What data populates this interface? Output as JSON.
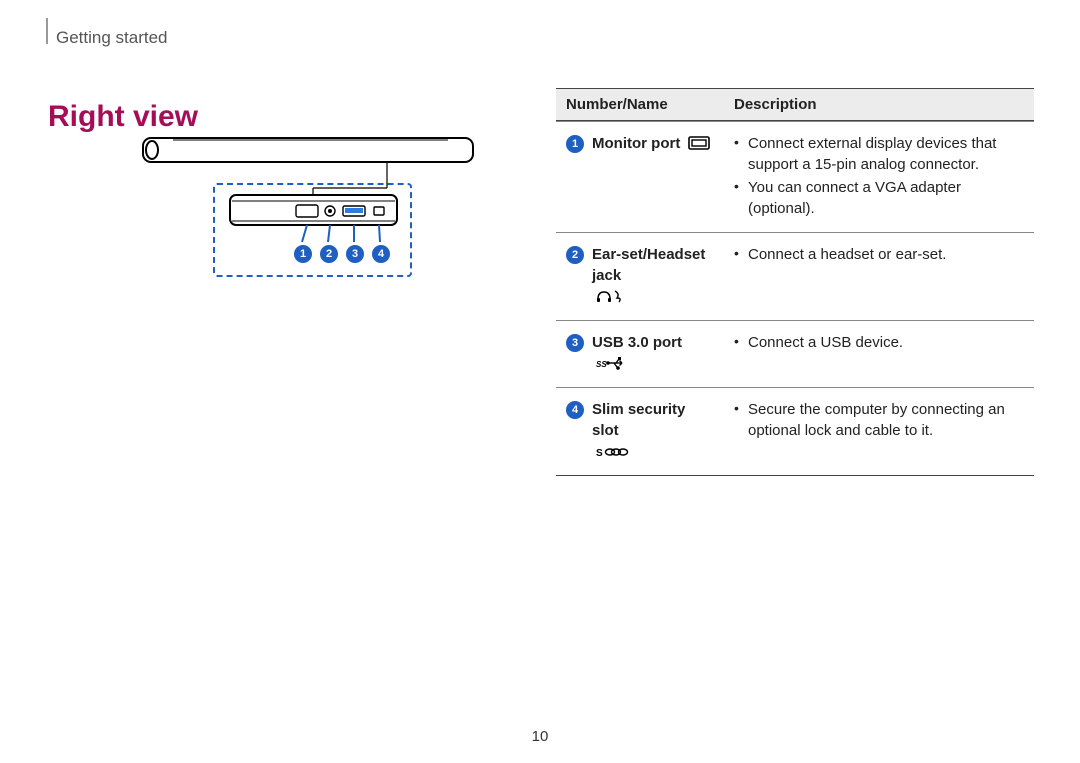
{
  "header": {
    "section": "Getting started"
  },
  "title": "Right view",
  "callouts": [
    "1",
    "2",
    "3",
    "4"
  ],
  "table": {
    "headers": {
      "name": "Number/Name",
      "desc": "Description"
    },
    "rows": [
      {
        "num": "1",
        "name": "Monitor port",
        "icon": "monitor-port-icon",
        "desc": [
          "Connect external display devices that support a 15-pin analog connector.",
          "You can connect a VGA adapter (optional)."
        ]
      },
      {
        "num": "2",
        "name": "Ear-set/Headset jack",
        "icon": "headset-jack-icon",
        "desc": [
          "Connect a headset or ear-set."
        ]
      },
      {
        "num": "3",
        "name": "USB 3.0 port",
        "icon": "usb3-port-icon",
        "desc": [
          "Connect a USB device."
        ]
      },
      {
        "num": "4",
        "name": "Slim security slot",
        "icon": "security-slot-icon",
        "desc": [
          "Secure the computer by connecting an optional lock and cable to it."
        ]
      }
    ]
  },
  "page_number": "10"
}
